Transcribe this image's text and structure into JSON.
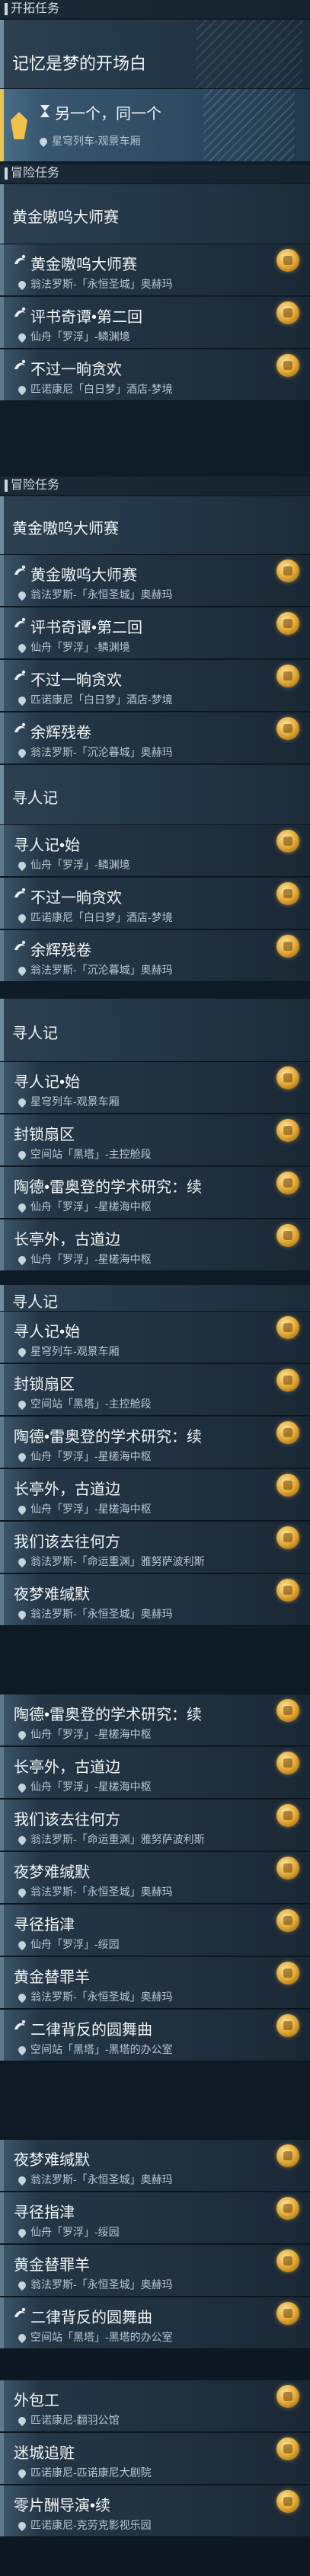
{
  "headers": {
    "trailblaze": "开拓任务",
    "adventure": "冒险任务"
  },
  "trailblaze": {
    "chapter": "记忆是梦的开场白",
    "quest_title": "另一个，同一个",
    "quest_location": "星穹列车-观景车厢"
  },
  "groups": {
    "g1": "黄金嗷呜大师赛",
    "g2": "黄金嗷呜大师赛",
    "g3": "寻人记",
    "g4": "寻人记",
    "g5": "寻人记"
  },
  "quests": [
    {
      "title": "黄金嗷呜大师赛",
      "loc": "翁法罗斯-「永恒圣城」奥赫玛"
    },
    {
      "title": "评书奇谭•第二回",
      "loc": "仙舟「罗浮」-鳞渊境"
    },
    {
      "title": "不过一晌贪欢",
      "loc": "匹诺康尼「白日梦」酒店-梦境"
    },
    {
      "title": "黄金嗷呜大师赛",
      "loc": "翁法罗斯-「永恒圣城」奥赫玛"
    },
    {
      "title": "评书奇谭•第二回",
      "loc": "仙舟「罗浮」-鳞渊境"
    },
    {
      "title": "不过一晌贪欢",
      "loc": "匹诺康尼「白日梦」酒店-梦境"
    },
    {
      "title": "余辉残卷",
      "loc": "翁法罗斯-「沉沦暮城」奥赫玛"
    },
    {
      "title": "寻人记•始",
      "loc": "仙舟「罗浮」-鳞渊境"
    },
    {
      "title": "不过一晌贪欢",
      "loc": "匹诺康尼「白日梦」酒店-梦境"
    },
    {
      "title": "余辉残卷",
      "loc": "翁法罗斯-「沉沦暮城」奥赫玛"
    },
    {
      "title": "寻人记•始",
      "loc": "星穹列车-观景车厢"
    },
    {
      "title": "封锁扇区",
      "loc": "空间站「黑塔」-主控舱段"
    },
    {
      "title": "陶德•雷奥登的学术研究：续",
      "loc": "仙舟「罗浮」-星槎海中枢"
    },
    {
      "title": "长亭外，古道边",
      "loc": "仙舟「罗浮」-星槎海中枢"
    },
    {
      "title": "寻人记•始",
      "loc": "星穹列车-观景车厢"
    },
    {
      "title": "封锁扇区",
      "loc": "空间站「黑塔」-主控舱段"
    },
    {
      "title": "陶德•雷奥登的学术研究：续",
      "loc": "仙舟「罗浮」-星槎海中枢"
    },
    {
      "title": "长亭外，古道边",
      "loc": "仙舟「罗浮」-星槎海中枢"
    },
    {
      "title": "我们该去往何方",
      "loc": "翁法罗斯-「命运重渊」雅努萨波利斯"
    },
    {
      "title": "夜梦难缄默",
      "loc": "翁法罗斯-「永恒圣城」奥赫玛"
    },
    {
      "title": "陶德•雷奥登的学术研究：续",
      "loc": "仙舟「罗浮」-星槎海中枢"
    },
    {
      "title": "长亭外，古道边",
      "loc": "仙舟「罗浮」-星槎海中枢"
    },
    {
      "title": "我们该去往何方",
      "loc": "翁法罗斯-「命运重渊」雅努萨波利斯"
    },
    {
      "title": "夜梦难缄默",
      "loc": "翁法罗斯-「永恒圣城」奥赫玛"
    },
    {
      "title": "寻径指津",
      "loc": "仙舟「罗浮」-绥园"
    },
    {
      "title": "黄金替罪羊",
      "loc": "翁法罗斯-「永恒圣城」奥赫玛"
    },
    {
      "title": "二律背反的圆舞曲",
      "loc": "空间站「黑塔」-黑塔的办公室"
    },
    {
      "title": "夜梦难缄默",
      "loc": "翁法罗斯-「永恒圣城」奥赫玛"
    },
    {
      "title": "寻径指津",
      "loc": "仙舟「罗浮」-绥园"
    },
    {
      "title": "黄金替罪羊",
      "loc": "翁法罗斯-「永恒圣城」奥赫玛"
    },
    {
      "title": "二律背反的圆舞曲",
      "loc": "空间站「黑塔」-黑塔的办公室"
    },
    {
      "title": "外包工",
      "loc": "匹诺康尼-翻羽公馆"
    },
    {
      "title": "迷城追赃",
      "loc": "匹诺康尼-匹诺康尼大剧院"
    },
    {
      "title": "零片酬导演•续",
      "loc": "匹诺康尼-克劳克影视乐园"
    }
  ]
}
